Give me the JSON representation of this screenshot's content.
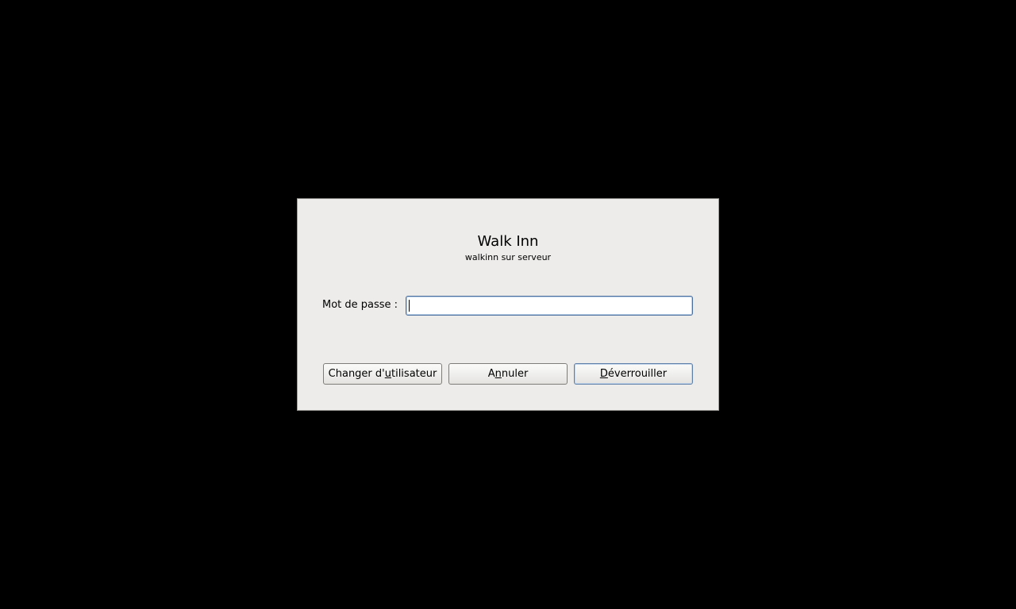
{
  "dialog": {
    "title": "Walk Inn",
    "subtitle": "walkinn sur serveur",
    "password": {
      "label": "Mot de passe :",
      "value": ""
    },
    "buttons": {
      "switch_user": {
        "before": "Changer d'",
        "mnemonic": "u",
        "after": "tilisateur"
      },
      "cancel": {
        "before": "A",
        "mnemonic": "n",
        "after": "nuler"
      },
      "unlock": {
        "before": "",
        "mnemonic": "D",
        "after": "éverrouiller"
      }
    }
  },
  "colors": {
    "background": "#000000",
    "dialog_bg": "#edecea",
    "focus_border": "#4a6e9e"
  }
}
